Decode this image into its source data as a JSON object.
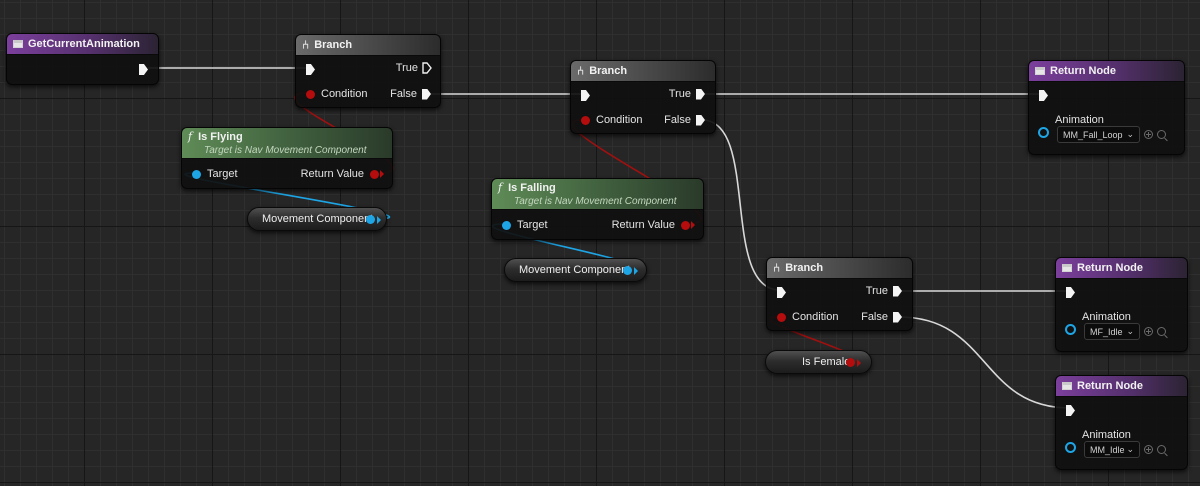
{
  "nodes": {
    "entry": {
      "title": "GetCurrentAnimation"
    },
    "branch1": {
      "title": "Branch",
      "condition": "Condition",
      "true_label": "True",
      "false_label": "False"
    },
    "branch2": {
      "title": "Branch",
      "condition": "Condition",
      "true_label": "True",
      "false_label": "False"
    },
    "branch3": {
      "title": "Branch",
      "condition": "Condition",
      "true_label": "True",
      "false_label": "False"
    },
    "is_flying": {
      "title": "Is Flying",
      "subtitle": "Target is Nav Movement Component",
      "target": "Target",
      "return_value": "Return Value"
    },
    "is_falling": {
      "title": "Is Falling",
      "subtitle": "Target is Nav Movement Component",
      "target": "Target",
      "return_value": "Return Value"
    },
    "movement1": {
      "label": "Movement Component"
    },
    "movement2": {
      "label": "Movement Component"
    },
    "is_female": {
      "label": "Is Female"
    },
    "return1": {
      "title": "Return Node",
      "param": "Animation",
      "value": "MM_Fall_Loop"
    },
    "return2": {
      "title": "Return Node",
      "param": "Animation",
      "value": "MF_Idle"
    },
    "return3": {
      "title": "Return Node",
      "param": "Animation",
      "value": "MM_Idle"
    }
  },
  "icons": {
    "function_entry": "function-icon",
    "branch": "branch-icon",
    "pure_function": "f-icon",
    "dropdown": "chevron-down-icon",
    "add": "plus-circle-icon",
    "browse": "search-icon"
  },
  "colors": {
    "exec_pin": "#f4f4f4",
    "bool_pin": "#b50d0d",
    "object_pin": "#1ea5e6",
    "function_header": "#7b3f9c",
    "pure_header": "#5f8c57",
    "branch_header": "#6a6a6a"
  }
}
